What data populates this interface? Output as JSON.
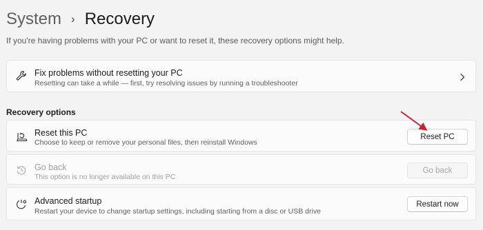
{
  "header": {
    "parent": "System",
    "separator": "›",
    "current": "Recovery"
  },
  "intro": "If you're having problems with your PC or want to reset it, these recovery options might help.",
  "fix_card": {
    "title": "Fix problems without resetting your PC",
    "description": "Resetting can take a while — first, try resolving issues by running a troubleshooter",
    "icon": "wrench-icon",
    "action_icon": "chevron-right-icon"
  },
  "section_label": "Recovery options",
  "options": [
    {
      "title": "Reset this PC",
      "description": "Choose to keep or remove your personal files, then reinstall Windows",
      "button": "Reset PC",
      "icon": "reset-pc-icon",
      "enabled": true
    },
    {
      "title": "Go back",
      "description": "This option is no longer available on this PC",
      "button": "Go back",
      "icon": "history-icon",
      "enabled": false
    },
    {
      "title": "Advanced startup",
      "description": "Restart your device to change startup settings, including starting from a disc or USB drive",
      "button": "Restart now",
      "icon": "advanced-startup-icon",
      "enabled": true
    }
  ],
  "annotation": {
    "arrow_color": "#d0202a"
  },
  "colors": {
    "background": "#f3f3f3",
    "card": "#fbfbfb",
    "disabled_text": "#a0a0a0"
  }
}
